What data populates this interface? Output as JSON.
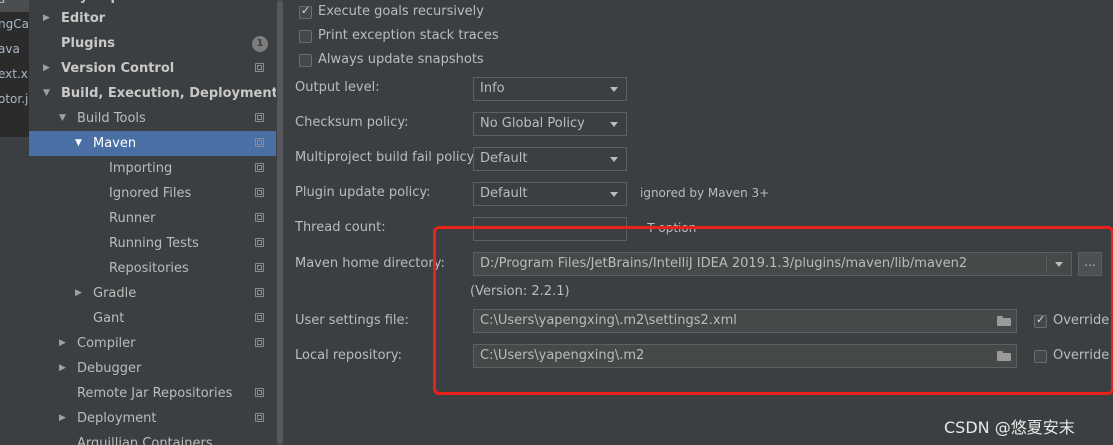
{
  "left_tabs": [
    "ngCa",
    "ava",
    "ext.xr",
    "otor.ja"
  ],
  "tree": {
    "top_partial": "Keymap",
    "items": [
      {
        "label": "Editor",
        "bold": true
      },
      {
        "label": "Plugins",
        "bold": true,
        "badge": "1"
      },
      {
        "label": "Version Control",
        "bold": true
      },
      {
        "label": "Build, Execution, Deployment",
        "bold": true
      },
      {
        "label": "Build Tools"
      },
      {
        "label": "Maven"
      },
      {
        "label": "Importing"
      },
      {
        "label": "Ignored Files"
      },
      {
        "label": "Runner"
      },
      {
        "label": "Running Tests"
      },
      {
        "label": "Repositories"
      },
      {
        "label": "Gradle"
      },
      {
        "label": "Gant"
      },
      {
        "label": "Compiler"
      },
      {
        "label": "Debugger"
      },
      {
        "label": "Remote Jar Repositories"
      },
      {
        "label": "Deployment"
      },
      {
        "label": "Arquillian Containers"
      }
    ]
  },
  "options": {
    "execute_recursively": "Execute goals recursively",
    "print_exception": "Print exception stack traces",
    "always_update": "Always update snapshots"
  },
  "form": {
    "output_level_label": "Output level:",
    "output_level_value": "Info",
    "checksum_label": "Checksum policy:",
    "checksum_value": "No Global Policy",
    "multiproject_label": "Multiproject build fail policy:",
    "multiproject_value": "Default",
    "plugin_update_label": "Plugin update policy:",
    "plugin_update_value": "Default",
    "plugin_update_note": "ignored by Maven 3+",
    "thread_count_label": "Thread count:",
    "thread_count_note": "-T option",
    "maven_home_label": "Maven home directory:",
    "maven_home_value": "D:/Program Files/JetBrains/IntelliJ IDEA 2019.1.3/plugins/maven/lib/maven2",
    "browse_label": "...",
    "version_text": "(Version: 2.2.1)",
    "user_settings_label": "User settings file:",
    "user_settings_value": "C:\\Users\\yapengxing\\.m2\\settings2.xml",
    "override_label": "Override",
    "local_repo_label": "Local repository:",
    "local_repo_value": "C:\\Users\\yapengxing\\.m2"
  },
  "watermark": "CSDN @悠夏安末",
  "colors": {
    "selection": "#4a6fa5",
    "highlight_box": "#e8221a"
  }
}
